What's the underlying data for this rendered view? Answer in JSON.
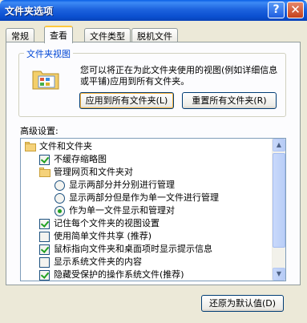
{
  "window": {
    "title": "文件夹选项",
    "help_glyph": "?",
    "close_glyph": "✕"
  },
  "tabs": [
    {
      "label": "常规"
    },
    {
      "label": "查看",
      "active": true
    },
    {
      "label": "文件类型"
    },
    {
      "label": "脱机文件"
    }
  ],
  "folder_views": {
    "title": "文件夹视图",
    "description": "您可以将正在为此文件夹使用的视图(例如详细信息或平铺)应用到所有文件夹。",
    "apply_button": "应用到所有文件夹(L)",
    "reset_button": "重置所有文件夹(R)"
  },
  "advanced": {
    "label": "高级设置:",
    "items": [
      {
        "type": "folder",
        "label": "文件和文件夹"
      },
      {
        "type": "checkbox",
        "checked": true,
        "label": "不缓存缩略图"
      },
      {
        "type": "folder",
        "label": "管理网页和文件夹对"
      },
      {
        "type": "radio",
        "checked": false,
        "label": "显示两部分并分别进行管理"
      },
      {
        "type": "radio",
        "checked": false,
        "label": "显示两部分但是作为单一文件进行管理"
      },
      {
        "type": "radio",
        "checked": true,
        "label": "作为单一文件显示和管理对"
      },
      {
        "type": "checkbox",
        "checked": true,
        "label": "记住每个文件夹的视图设置"
      },
      {
        "type": "checkbox",
        "checked": false,
        "label": "使用简单文件共享 (推荐)"
      },
      {
        "type": "checkbox",
        "checked": true,
        "label": "鼠标指向文件夹和桌面项时显示提示信息"
      },
      {
        "type": "checkbox",
        "checked": false,
        "label": "显示系统文件夹的内容"
      },
      {
        "type": "checkbox",
        "checked": true,
        "label": "隐藏受保护的操作系统文件(推荐)"
      }
    ]
  },
  "restore_button": "还原为默认值(D)",
  "colors": {
    "title_bar": "#0a4fd0",
    "group_title": "#0046d5",
    "check_mark": "#21a121"
  }
}
